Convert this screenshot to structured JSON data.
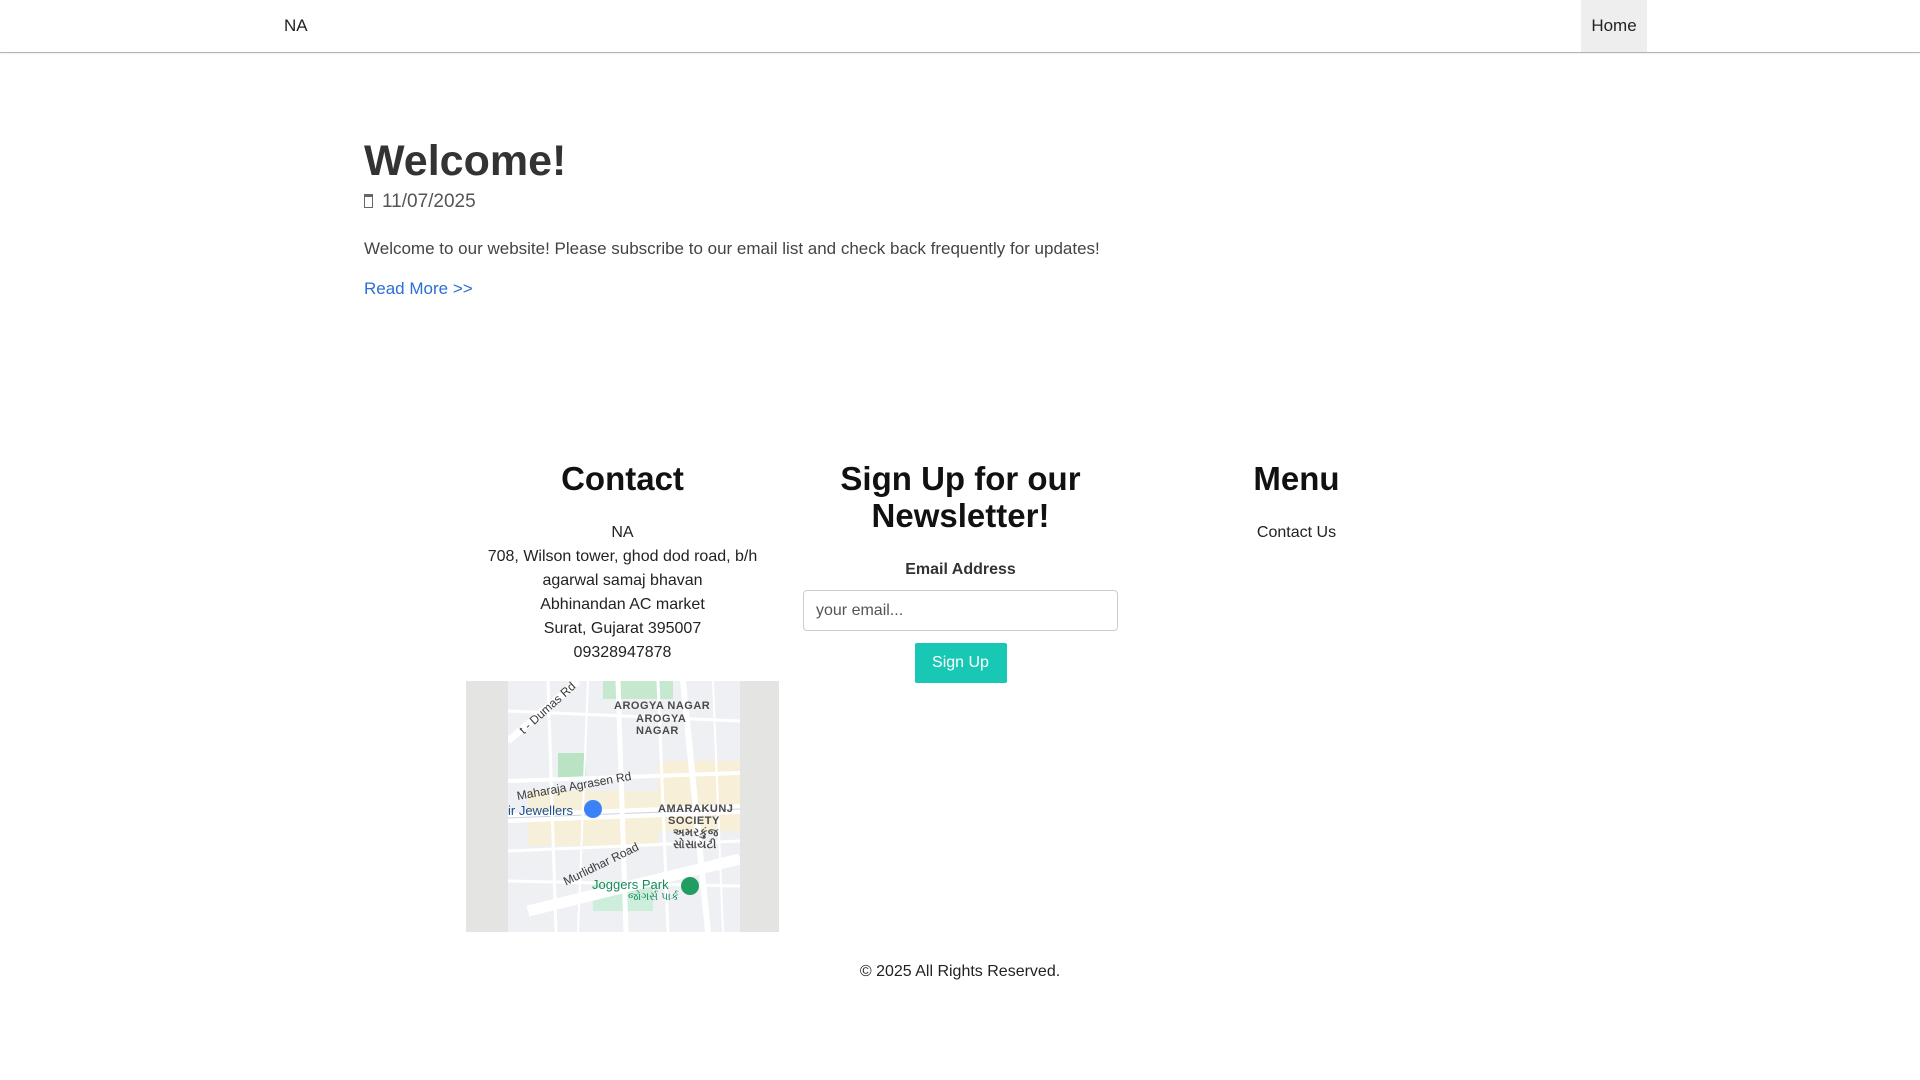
{
  "nav": {
    "brand": "NA",
    "home_label": "Home"
  },
  "post": {
    "title": "Welcome!",
    "date": "11/07/2025",
    "date_icon": "calendar-icon",
    "body": "Welcome to our website! Please subscribe to our email list and check back frequently for updates!",
    "read_more": "Read More >>"
  },
  "contact": {
    "title": "Contact",
    "lines": [
      "NA",
      "708, Wilson tower, ghod dod road, b/h",
      "agarwal samaj bhavan",
      "Abhinandan AC market",
      "Surat, Gujarat 395007",
      "09328947878"
    ],
    "map": {
      "labels": {
        "road1": "t - Dumas Rd",
        "area1a": "AROGYA NAGAR",
        "area1b": "AROGYA",
        "area1c": "NAGAR",
        "road2": "Maharaja Agrasen Rd",
        "poi1": "ir Jewellers",
        "area2a": "AMARAKUNJ",
        "area2b": "SOCIETY",
        "area2c": "અમરકુંજ",
        "area2d": "સોસાયટી",
        "road3": "Murlidhar Road",
        "park1": "Joggers Park",
        "park1b": "જોગર્સ પાર્ક"
      }
    }
  },
  "newsletter": {
    "title": "Sign Up for our Newsletter!",
    "email_label": "Email Address",
    "email_placeholder": "your email...",
    "email_value": "",
    "button_label": "Sign Up"
  },
  "menu": {
    "title": "Menu",
    "items": [
      "Contact Us"
    ]
  },
  "footer": {
    "copyright": "© 2025 All Rights Reserved."
  },
  "colors": {
    "accent_button": "#18c8b4",
    "link": "#2a6ed8",
    "nav_active_bg": "#eeeeee"
  }
}
